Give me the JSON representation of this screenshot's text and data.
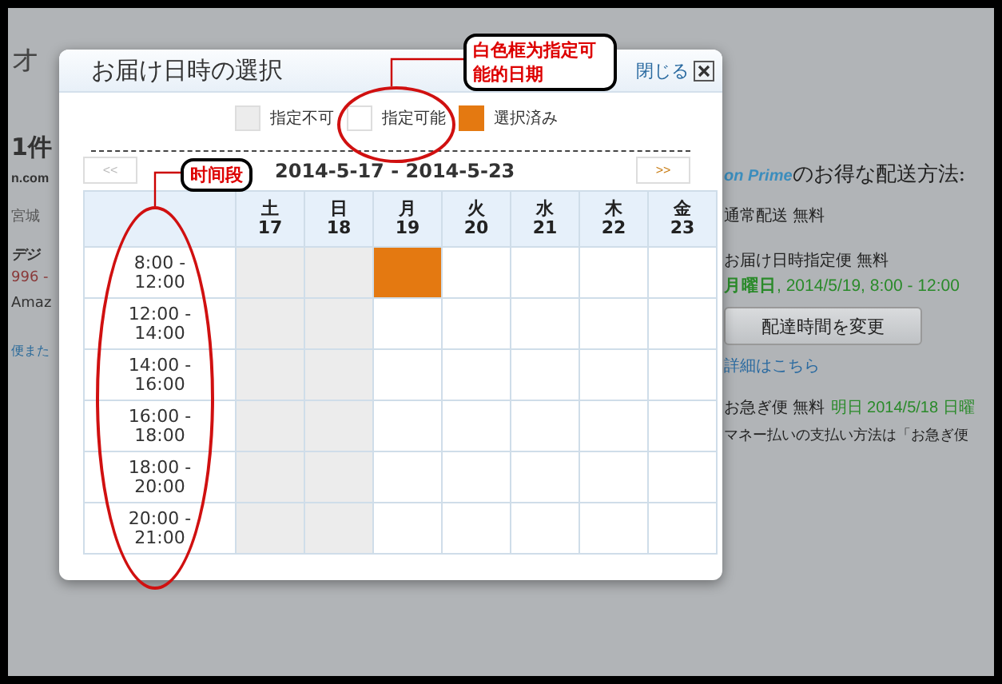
{
  "page": {
    "left_texts": [
      "オ",
      "1件",
      "n.com",
      "宮城",
      "デジ",
      "996 -",
      "Amaz",
      "便また"
    ],
    "prime_logo": "on Prime",
    "heading": "のお得な配送方法:",
    "standard": "通常配送 無料",
    "scheduled_label": "お届け日時指定便 無料",
    "scheduled_value": "**月曜日**, 2014/5/19, 8:00 - 12:00",
    "change_button": "配達時間を変更",
    "details_link": "詳細はこちら",
    "express": "お急ぎ便 無料",
    "express_date": "明日 2014/5/18 日曜",
    "note": "マネー払いの支払い方法は「お急ぎ便"
  },
  "dialog": {
    "title": "お届け日時の選択",
    "close": "閉じる",
    "legend": [
      {
        "label": "指定不可",
        "kind": "unavailable"
      },
      {
        "label": "指定可能",
        "kind": "available"
      },
      {
        "label": "選択済み",
        "kind": "selected"
      }
    ],
    "prev": "<<",
    "prev_disabled": true,
    "range": "2014-5-17 - 2014-5-23",
    "next": ">>",
    "days": [
      {
        "weekday": "土",
        "date": "17"
      },
      {
        "weekday": "日",
        "date": "18"
      },
      {
        "weekday": "月",
        "date": "19"
      },
      {
        "weekday": "火",
        "date": "20"
      },
      {
        "weekday": "水",
        "date": "21"
      },
      {
        "weekday": "木",
        "date": "22"
      },
      {
        "weekday": "金",
        "date": "23"
      }
    ],
    "slots": [
      {
        "time": "8:00 - 12:00",
        "cells": [
          {
            "kind": "unavailable"
          },
          {
            "kind": "unavailable"
          },
          {
            "kind": "selected"
          },
          {
            "kind": "available"
          },
          {
            "kind": "available"
          },
          {
            "kind": "available"
          },
          {
            "kind": "available"
          }
        ]
      },
      {
        "time": "12:00 - 14:00",
        "cells": [
          {
            "kind": "unavailable"
          },
          {
            "kind": "unavailable"
          },
          {
            "kind": "available"
          },
          {
            "kind": "available"
          },
          {
            "kind": "available"
          },
          {
            "kind": "available"
          },
          {
            "kind": "available"
          }
        ]
      },
      {
        "time": "14:00 - 16:00",
        "cells": [
          {
            "kind": "unavailable"
          },
          {
            "kind": "unavailable"
          },
          {
            "kind": "available"
          },
          {
            "kind": "available"
          },
          {
            "kind": "available"
          },
          {
            "kind": "available"
          },
          {
            "kind": "available"
          }
        ]
      },
      {
        "time": "16:00 - 18:00",
        "cells": [
          {
            "kind": "unavailable"
          },
          {
            "kind": "unavailable"
          },
          {
            "kind": "available"
          },
          {
            "kind": "available"
          },
          {
            "kind": "available"
          },
          {
            "kind": "available"
          },
          {
            "kind": "available"
          }
        ]
      },
      {
        "time": "18:00 - 20:00",
        "cells": [
          {
            "kind": "unavailable"
          },
          {
            "kind": "unavailable"
          },
          {
            "kind": "available"
          },
          {
            "kind": "available"
          },
          {
            "kind": "available"
          },
          {
            "kind": "available"
          },
          {
            "kind": "available"
          }
        ]
      },
      {
        "time": "20:00 - 21:00",
        "cells": [
          {
            "kind": "unavailable"
          },
          {
            "kind": "unavailable"
          },
          {
            "kind": "available"
          },
          {
            "kind": "available"
          },
          {
            "kind": "available"
          },
          {
            "kind": "available"
          },
          {
            "kind": "available"
          }
        ]
      }
    ]
  },
  "annotations": [
    {
      "text": "白色框为指定可能的日期"
    },
    {
      "text": "时间段"
    }
  ]
}
